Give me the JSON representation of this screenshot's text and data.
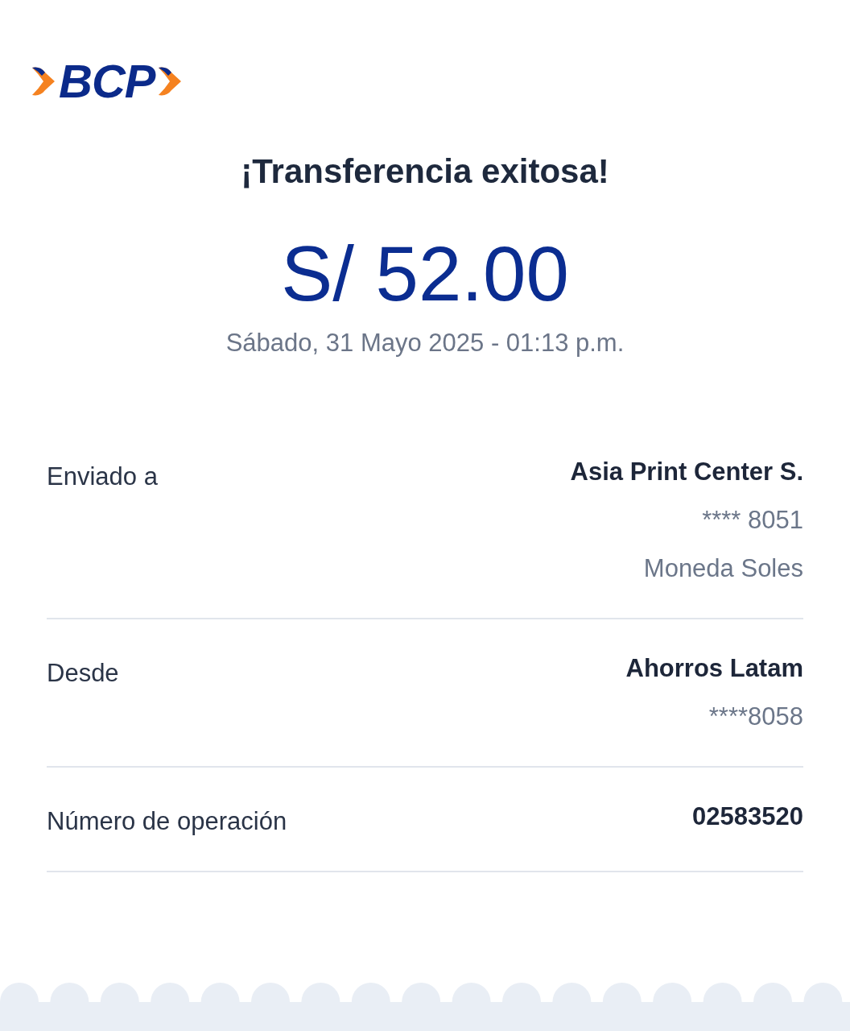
{
  "logo": {
    "text": "BCP"
  },
  "title": "¡Transferencia exitosa!",
  "amount": "S/ 52.00",
  "datetime": "Sábado, 31 Mayo 2025 - 01:13 p.m.",
  "details": [
    {
      "label": "Enviado a",
      "values": [
        {
          "text": "Asia Print Center S.",
          "kind": "primary"
        },
        {
          "text": "**** 8051",
          "kind": "secondary"
        },
        {
          "text": "Moneda Soles",
          "kind": "secondary"
        }
      ]
    },
    {
      "label": "Desde",
      "values": [
        {
          "text": "Ahorros Latam",
          "kind": "primary"
        },
        {
          "text": "****8058",
          "kind": "secondary"
        }
      ]
    },
    {
      "label": "Número de operación",
      "values": [
        {
          "text": "02583520",
          "kind": "primary"
        }
      ]
    }
  ]
}
